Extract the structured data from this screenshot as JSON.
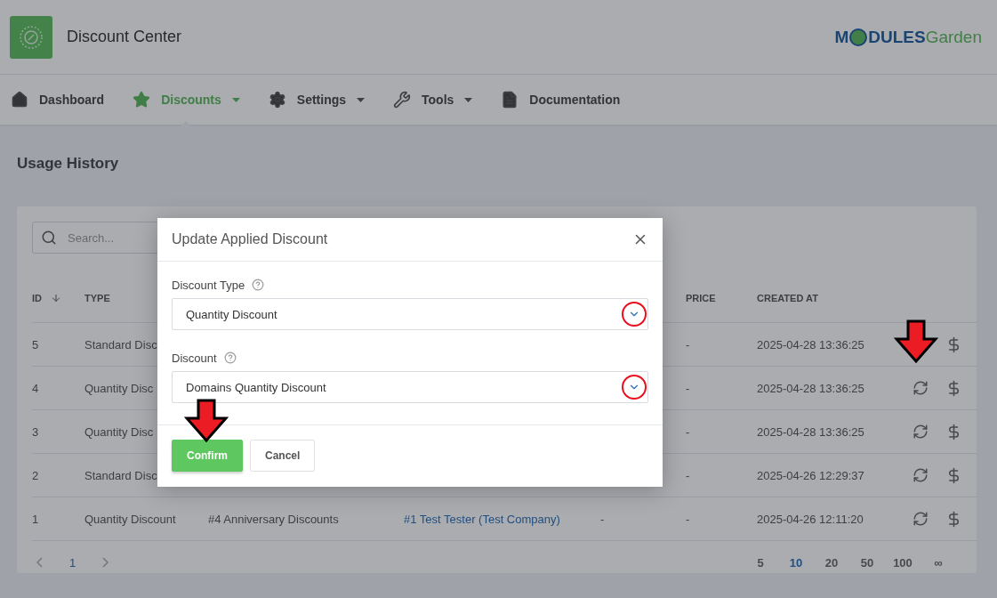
{
  "app": {
    "title": "Discount Center"
  },
  "brand": {
    "prefix": "M",
    "strong": "DULES",
    "light": "Garden"
  },
  "nav": [
    {
      "label": "Dashboard",
      "selected": false,
      "dropdown": false
    },
    {
      "label": "Discounts",
      "selected": true,
      "dropdown": true
    },
    {
      "label": "Settings",
      "selected": false,
      "dropdown": true
    },
    {
      "label": "Tools",
      "selected": false,
      "dropdown": true
    },
    {
      "label": "Documentation",
      "selected": false,
      "dropdown": false
    }
  ],
  "page_title": "Usage History",
  "search": {
    "placeholder": "Search..."
  },
  "table": {
    "columns": [
      {
        "label": "ID",
        "sorted": true
      },
      {
        "label": "TYPE",
        "sorted": false
      },
      null,
      null,
      null,
      {
        "label": "PRICE",
        "sorted": false
      },
      {
        "label": "CREATED AT",
        "sorted": false
      },
      null
    ],
    "rows": [
      {
        "cells": [
          "5",
          "Standard Disc",
          null,
          null,
          null,
          "-",
          "2025-04-28 13:36:25"
        ]
      },
      {
        "cells": [
          "4",
          "Quantity Disc",
          null,
          null,
          null,
          "-",
          "2025-04-28 13:36:25"
        ]
      },
      {
        "cells": [
          "3",
          "Quantity Disc",
          null,
          null,
          null,
          "-",
          "2025-04-28 13:36:25"
        ]
      },
      {
        "cells": [
          "2",
          "Standard Disc",
          null,
          null,
          null,
          "-",
          "2025-04-26 12:29:37"
        ]
      },
      {
        "cells": [
          "1",
          "Quantity Discount",
          "#4 Anniversary Discounts",
          "#1 Test Tester (Test Company)",
          "-",
          "-",
          "2025-04-26 12:11:20"
        ]
      }
    ]
  },
  "pagination": {
    "pages": [
      {
        "label": "1",
        "selected": true
      }
    ],
    "page_sizes": [
      {
        "label": "5",
        "selected": false
      },
      {
        "label": "10",
        "selected": true
      },
      {
        "label": "20",
        "selected": false
      },
      {
        "label": "50",
        "selected": false
      },
      {
        "label": "100",
        "selected": false
      },
      {
        "label": "∞",
        "selected": false
      }
    ]
  },
  "modal": {
    "title": "Update Applied Discount",
    "fields": [
      {
        "label": "Discount Type",
        "value": "Quantity Discount"
      },
      {
        "label": "Discount",
        "value": "Domains Quantity Discount"
      }
    ],
    "buttons": [
      {
        "label": "Confirm",
        "kind": "primary"
      },
      {
        "label": "Cancel",
        "kind": "secondary"
      }
    ]
  }
}
